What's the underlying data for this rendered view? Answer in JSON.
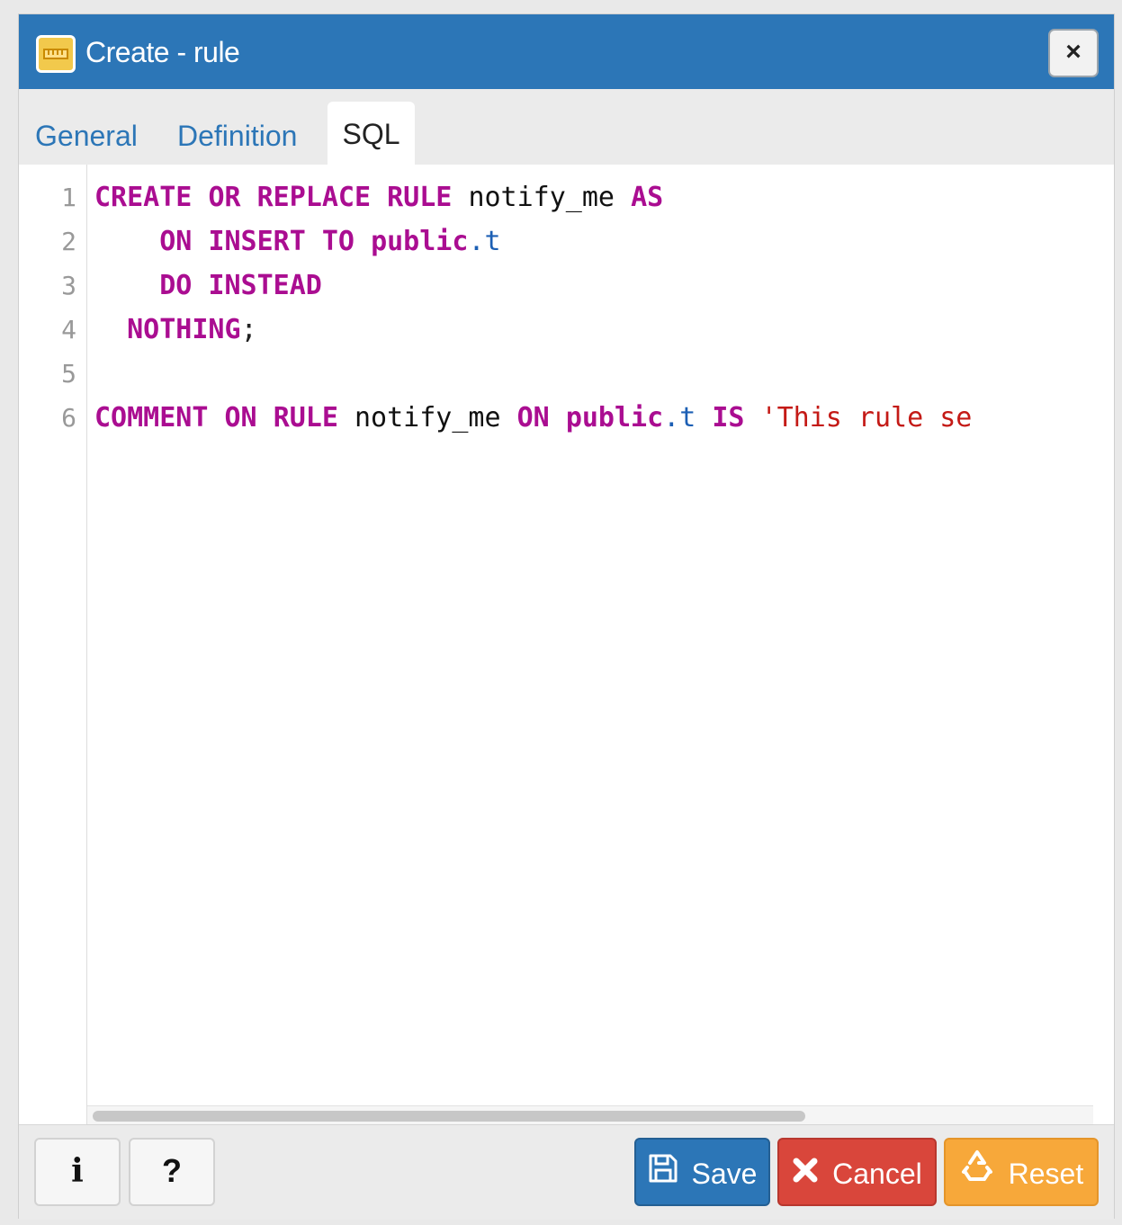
{
  "dialog": {
    "title": "Create - rule",
    "close_label": "×"
  },
  "tabs": [
    {
      "label": "General",
      "active": false
    },
    {
      "label": "Definition",
      "active": false
    },
    {
      "label": "SQL",
      "active": true
    }
  ],
  "editor": {
    "line_numbers": [
      "1",
      "2",
      "3",
      "4",
      "5",
      "6"
    ],
    "lines": [
      "CREATE OR REPLACE RULE notify_me AS",
      "    ON INSERT TO public.t",
      "    DO INSTEAD",
      "  NOTHING;",
      "",
      "COMMENT ON RULE notify_me ON public.t IS 'This rule se"
    ]
  },
  "footer": {
    "info_label": "i",
    "help_label": "?",
    "save_label": "Save",
    "cancel_label": "Cancel",
    "reset_label": "Reset"
  },
  "colors": {
    "titlebar": "#2c76b7",
    "save": "#2c76b7",
    "cancel": "#d9463b",
    "reset": "#f7a83a",
    "keyword": "#aa0d91",
    "variable": "#1c5fb4",
    "string": "#c41a16"
  },
  "icons": {
    "title": "rule-icon",
    "close": "close-icon",
    "save": "floppy-disk-icon",
    "cancel": "x-icon",
    "reset": "recycle-icon"
  }
}
